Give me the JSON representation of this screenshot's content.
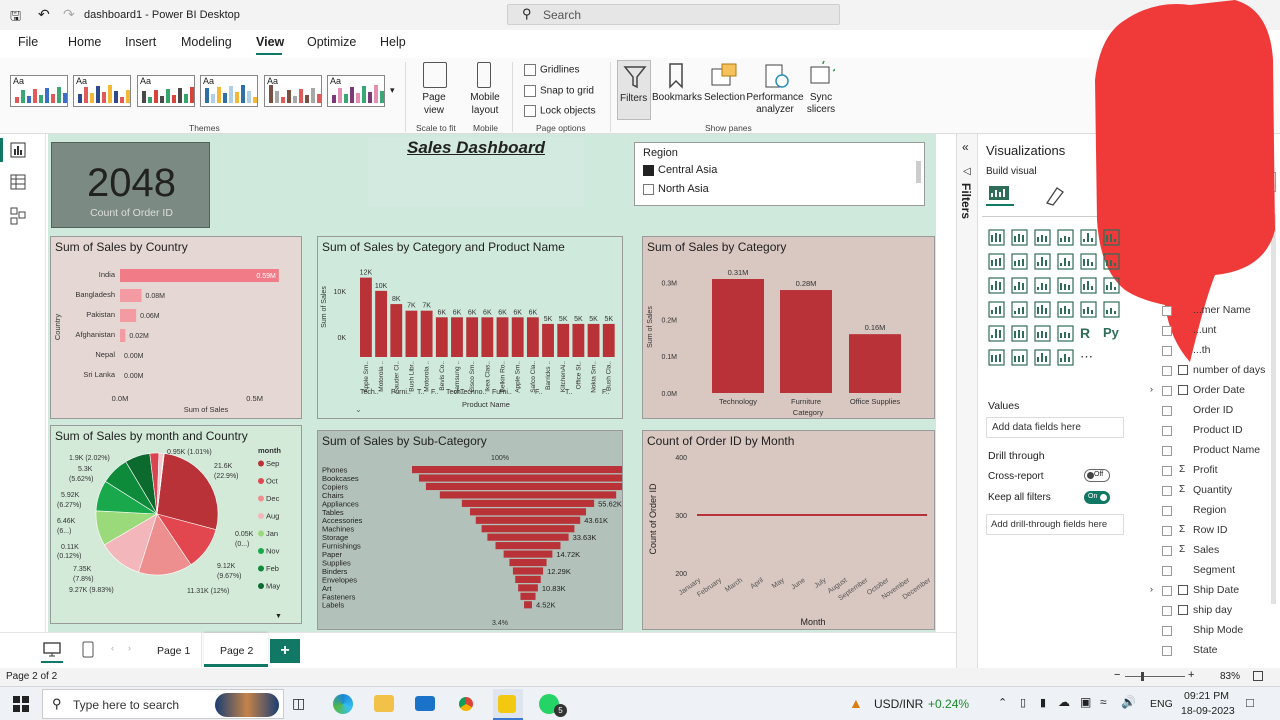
{
  "window": {
    "title": "dashboard1 - Power BI Desktop",
    "search_placeholder": "Search"
  },
  "menu": [
    "File",
    "Home",
    "Insert",
    "Modeling",
    "View",
    "Optimize",
    "Help"
  ],
  "active_menu": "View",
  "ribbon": {
    "themes_label": "Themes",
    "theme_aa": "Aa",
    "page_view": "Page view",
    "mobile_layout": "Mobile layout",
    "scale_to_fit": "Scale to fit",
    "mobile_group": "Mobile",
    "gridlines": "Gridlines",
    "snap": "Snap to grid",
    "lock": "Lock objects",
    "page_options": "Page options",
    "filters": "Filters",
    "bookmarks": "Bookmarks",
    "selection": "Selection",
    "performance": "Performance analyzer",
    "sync": "Sync slicers",
    "show_panes": "Show panes"
  },
  "dashboard": {
    "title": "Sales Dashboard",
    "kpi_value": "2048",
    "kpi_label": "Count of Order ID",
    "slicer": {
      "title": "Region",
      "items": [
        {
          "label": "Central Asia",
          "checked": true
        },
        {
          "label": "North Asia",
          "checked": false
        }
      ]
    }
  },
  "charts": {
    "country": {
      "title": "Sum of Sales by Country",
      "chart_data": {
        "type": "bar",
        "orientation": "horizontal",
        "categories": [
          "India",
          "Bangladesh",
          "Pakistan",
          "Afghanistan",
          "Nepal",
          "Sri Lanka"
        ],
        "values": [
          0.59,
          0.08,
          0.06,
          0.02,
          0.0,
          0.0
        ],
        "labels": [
          "0.59M",
          "0.08M",
          "0.06M",
          "0.02M",
          "0.00M",
          "0.00M"
        ],
        "xlabel": "Sum of Sales",
        "ylabel": "Country",
        "xticks": [
          "0.0M",
          "0.5M"
        ],
        "xlim": [
          0,
          0.65
        ]
      }
    },
    "product": {
      "title": "Sum of Sales by Category and Product Name",
      "chart_data": {
        "type": "bar",
        "labels": [
          "12K",
          "10K",
          "8K",
          "7K",
          "7K",
          "6K",
          "6K",
          "6K",
          "6K",
          "6K",
          "6K",
          "6K",
          "5K",
          "5K",
          "5K",
          "5K",
          "5K"
        ],
        "values": [
          12,
          10,
          8,
          7,
          7,
          6,
          6,
          6,
          6,
          6,
          6,
          6,
          5,
          5,
          5,
          5,
          5
        ],
        "categories": [
          "Apple Sm..",
          "Motorola ..",
          "Sauder Cl..",
          "Bush Libr..",
          "Motorola ..",
          "Bevis Co..",
          "Samsung ..",
          "Cisco Sm..",
          "Ikea Clas..",
          "Belkin Ro..",
          "Apple Sm..",
          "Safco Cla..",
          "Barricks ..",
          "KitchenAi..",
          "Office St..",
          "Nokia Sm..",
          "Bush Cla.."
        ],
        "groups": [
          "Tech..",
          "Furni..",
          "T..",
          "F..",
          "Tech..",
          "Techno..",
          "Furni..",
          "F..",
          "T..",
          "F.."
        ],
        "xlabel": "Product Name",
        "ylabel": "Sum of Sales",
        "yticks": [
          "0K",
          "10K"
        ],
        "ylim": [
          0,
          13
        ]
      }
    },
    "category": {
      "title": "Sum of Sales by Category",
      "chart_data": {
        "type": "bar",
        "categories": [
          "Technology",
          "Furniture",
          "Office Supplies"
        ],
        "values": [
          0.31,
          0.28,
          0.16
        ],
        "labels": [
          "0.31M",
          "0.28M",
          "0.16M"
        ],
        "xlabel": "Category",
        "ylabel": "Sum of Sales",
        "yticks": [
          "0.0M",
          "0.1M",
          "0.2M",
          "0.3M"
        ],
        "ylim": [
          0,
          0.3
        ]
      }
    },
    "pie": {
      "title": "Sum of Sales by month and Country",
      "legend_title": "month",
      "legend": [
        {
          "label": "Sep",
          "color": "#b83238"
        },
        {
          "label": "Oct",
          "color": "#e2474f"
        },
        {
          "label": "Dec",
          "color": "#ee8f8f"
        },
        {
          "label": "Aug",
          "color": "#f3b6bb"
        },
        {
          "label": "Jan",
          "color": "#9ada7a"
        },
        {
          "label": "Nov",
          "color": "#19a84b"
        },
        {
          "label": "Feb",
          "color": "#0e8a3b"
        },
        {
          "label": "May",
          "color": "#0c6a2e"
        }
      ],
      "chart_data": {
        "type": "pie",
        "values": [
          21.6,
          9.12,
          11.31,
          9.27,
          7.35,
          6.46,
          5.92,
          5.3,
          1.9,
          0.95,
          0.11,
          0.05
        ],
        "colors": [
          "#b83238",
          "#e2474f",
          "#ee8f8f",
          "#f3b6bb",
          "#9ada7a",
          "#19a84b",
          "#0e8a3b",
          "#0c6a2e",
          "#d94452",
          "#f7c8cc",
          "#c8c8c8",
          "#ffe0e3"
        ]
      },
      "labels": [
        "0.95K (1.01%)",
        "21.6K",
        "(22.9%)",
        "1.9K (2.02%)",
        "5.3K",
        "(5.62%)",
        "5.92K",
        "(6.27%)",
        "6.46K",
        "(6...)",
        "0.11K",
        "(0.12%)",
        "7.35K",
        "(7.8%)",
        "9.27K (9.83%)",
        "11.31K (12%)",
        "9.12K",
        "(9.67%)",
        "0.05K",
        "(0...)"
      ]
    },
    "funnel": {
      "title": "Sum of Sales by Sub-Category",
      "top_pct": "100%",
      "bottom_pct": "3.4%",
      "chart_data": {
        "type": "funnel",
        "categories": [
          "Phones",
          "Bookcases",
          "Copiers",
          "Chairs",
          "Appliances",
          "Tables",
          "Accessories",
          "Machines",
          "Storage",
          "Furnishings",
          "Paper",
          "Supplies",
          "Binders",
          "Envelopes",
          "Art",
          "Fasteners",
          "Labels"
        ],
        "values": [
          100,
          94,
          88,
          76,
          57,
          50,
          45,
          40,
          35,
          28,
          21,
          16,
          13,
          11,
          8.5,
          6.5,
          3.4
        ],
        "labels": [
          "",
          "",
          "91.41K",
          "",
          "55.62K",
          "",
          "43.61K",
          "",
          "33.63K",
          "",
          "14.72K",
          "",
          "12.29K",
          "",
          "10.83K",
          "",
          "4.52K"
        ]
      }
    },
    "month": {
      "title": "Count of Order ID by Month",
      "chart_data": {
        "type": "line",
        "categories": [
          "January",
          "February",
          "March",
          "April",
          "May",
          "June",
          "July",
          "August",
          "September",
          "October",
          "November",
          "December"
        ],
        "values": [
          300,
          300,
          300,
          300,
          300,
          300,
          300,
          300,
          300,
          300,
          300,
          300
        ],
        "xlabel": "Month",
        "ylabel": "Count of Order ID",
        "yticks": [
          "200",
          "300",
          "400"
        ],
        "ylim": [
          200,
          400
        ]
      }
    }
  },
  "viz_pane": {
    "title": "Visualizations",
    "build_visual": "Build visual",
    "values": "Values",
    "add_data": "Add data fields here",
    "drill_through": "Drill through",
    "cross_report": "Cross-report",
    "cross_state": "Off",
    "keep_filters": "Keep all filters",
    "keep_state": "On",
    "add_drill": "Add drill-through fields here",
    "filters_label": "Filters",
    "py": "Py",
    "r": "R"
  },
  "fields": [
    {
      "label": "...mer Name",
      "sigma": false,
      "expand": false
    },
    {
      "label": "...unt",
      "sigma": false,
      "expand": false
    },
    {
      "label": "...th",
      "sigma": false,
      "expand": false
    },
    {
      "label": "number of days",
      "sigma": false,
      "table": true,
      "expand": false
    },
    {
      "label": "Order Date",
      "sigma": false,
      "table": true,
      "expand": true
    },
    {
      "label": "Order ID",
      "sigma": false,
      "expand": false
    },
    {
      "label": "Product ID",
      "sigma": false,
      "expand": false
    },
    {
      "label": "Product Name",
      "sigma": false,
      "expand": false
    },
    {
      "label": "Profit",
      "sigma": true,
      "expand": false
    },
    {
      "label": "Quantity",
      "sigma": true,
      "expand": false
    },
    {
      "label": "Region",
      "sigma": false,
      "expand": false
    },
    {
      "label": "Row ID",
      "sigma": true,
      "expand": false
    },
    {
      "label": "Sales",
      "sigma": true,
      "expand": false
    },
    {
      "label": "Segment",
      "sigma": false,
      "expand": false
    },
    {
      "label": "Ship Date",
      "sigma": false,
      "table": true,
      "expand": true
    },
    {
      "label": "ship day",
      "sigma": false,
      "table": true,
      "expand": false
    },
    {
      "label": "Ship Mode",
      "sigma": false,
      "expand": false
    },
    {
      "label": "State",
      "sigma": false,
      "expand": false
    }
  ],
  "pages": {
    "tabs": [
      "Page 1",
      "Page 2"
    ],
    "active": "Page 2",
    "add": "+"
  },
  "status": {
    "page": "Page 2 of 2",
    "zoom": "83%"
  },
  "taskbar": {
    "search": "Type here to search",
    "ticker": "USD/INR",
    "ticker_change": "+0.24%",
    "lang": "ENG",
    "time": "09:21 PM",
    "date": "18-09-2023",
    "whatsapp_badge": "5"
  }
}
